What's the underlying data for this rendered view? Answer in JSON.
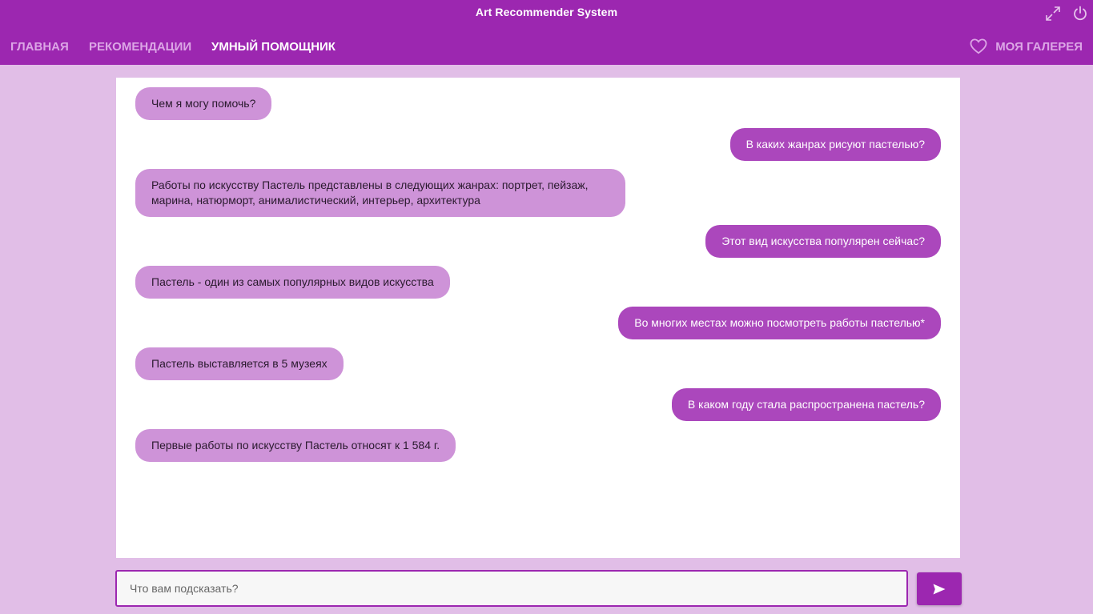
{
  "window": {
    "title": "Art Recommender System",
    "icons": {
      "fullscreen": "fullscreen-icon",
      "power": "power-icon"
    }
  },
  "nav": {
    "items": [
      {
        "label": "ГЛАВНАЯ",
        "active": false
      },
      {
        "label": "РЕКОМЕНДАЦИИ",
        "active": false
      },
      {
        "label": "УМНЫЙ ПОМОЩНИК",
        "active": true
      }
    ],
    "gallery_label": "МОЯ ГАЛЕРЕЯ",
    "gallery_icon": "heart-icon"
  },
  "chat": {
    "messages": [
      {
        "role": "bot",
        "text": "Чем я могу помочь?"
      },
      {
        "role": "user",
        "text": "В каких жанрах рисуют пастелью?"
      },
      {
        "role": "bot",
        "text": "Работы по искусству Пастель представлены в следующих жанрах: портрет, пейзаж, марина, натюрморт, анималистический, интерьер, архитектура"
      },
      {
        "role": "user",
        "text": "Этот вид искусства популярен сейчас?"
      },
      {
        "role": "bot",
        "text": "Пастель - один из самых популярных видов искусства"
      },
      {
        "role": "user",
        "text": "Во многих местах можно посмотреть работы пастелью*"
      },
      {
        "role": "bot",
        "text": "Пастель выставляется в 5 музеях"
      },
      {
        "role": "user",
        "text": "В каком году стала распространена пастель?"
      },
      {
        "role": "bot",
        "text": "Первые работы по искусству Пастель относят к 1 584 г."
      }
    ]
  },
  "input": {
    "placeholder": "Что вам подсказать?",
    "value": ""
  },
  "send": {
    "icon": "send-icon"
  },
  "colors": {
    "primary": "#9c27b0",
    "background": "#e1bee7",
    "bot_bubble": "#ce93d8",
    "user_bubble": "#ab47bc",
    "nav_inactive": "#dca6e6"
  }
}
